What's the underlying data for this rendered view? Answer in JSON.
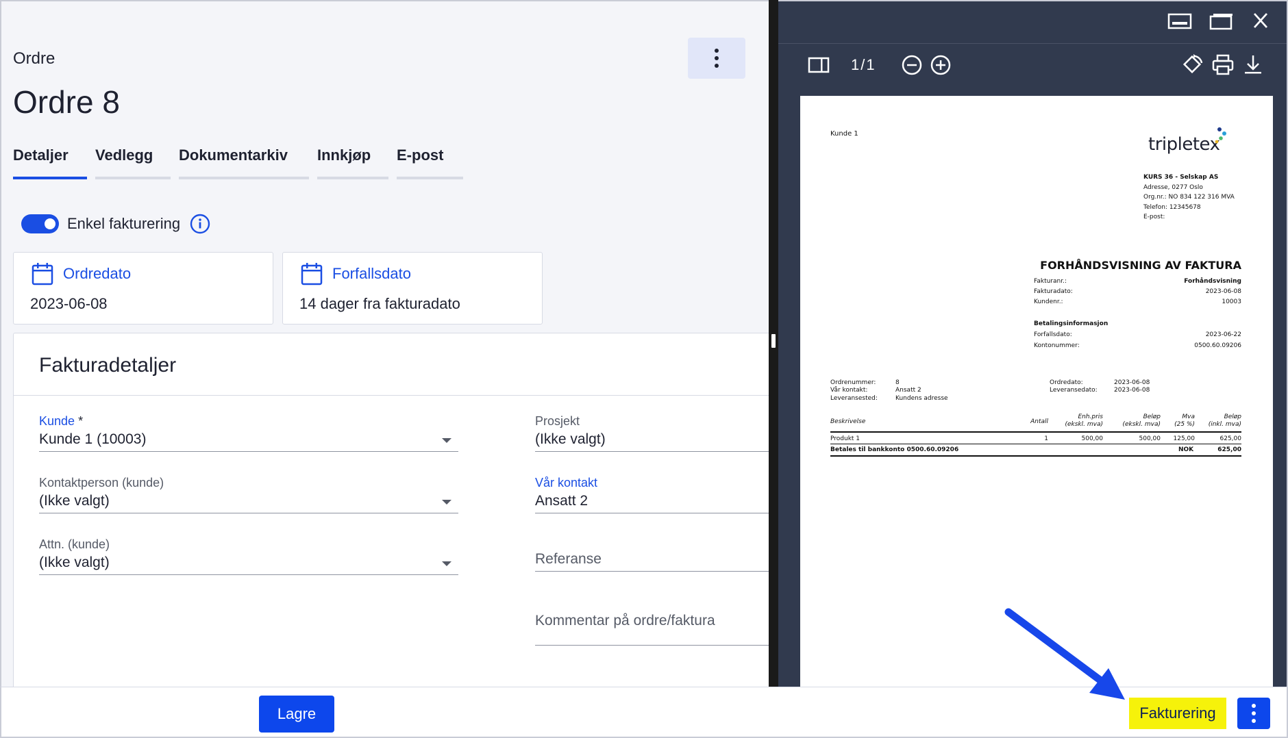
{
  "header": {
    "breadcrumb": "Ordre",
    "title": "Ordre 8"
  },
  "tabs": [
    "Detaljer",
    "Vedlegg",
    "Dokumentarkiv",
    "Innkjøp",
    "E-post"
  ],
  "simple_invoicing": {
    "label": "Enkel fakturering",
    "enabled": true
  },
  "dates": {
    "order_date": {
      "label": "Ordredato",
      "value": "2023-06-08"
    },
    "due_date": {
      "label": "Forfallsdato",
      "value": "14 dager fra fakturadato"
    }
  },
  "invoice_details": {
    "title": "Fakturadetaljer",
    "customer": {
      "label": "Kunde",
      "required_mark": "*",
      "value": "Kunde 1 (10003)"
    },
    "contact": {
      "label": "Kontaktperson (kunde)",
      "value": "(Ikke valgt)"
    },
    "attn": {
      "label": "Attn. (kunde)",
      "value": "(Ikke valgt)"
    },
    "project": {
      "label": "Prosjekt",
      "value": "(Ikke valgt)"
    },
    "our_contact": {
      "label": "Vår kontakt",
      "value": "Ansatt 2"
    },
    "reference": {
      "placeholder": "Referanse"
    },
    "comment": {
      "placeholder": "Kommentar på ordre/faktura"
    }
  },
  "viewer": {
    "page_count": "1/1",
    "icons": [
      "minimize-icon",
      "maximize-icon",
      "close-icon",
      "sidebar-toggle-icon",
      "zoom-out-icon",
      "zoom-in-icon",
      "rotate-icon",
      "print-icon",
      "download-icon"
    ]
  },
  "pdf": {
    "customer_name": "Kunde 1",
    "logo": "tripletex",
    "company": {
      "name": "KURS 36 - Selskap AS",
      "address": "Adresse, 0277 Oslo",
      "org": "Org.nr.:  NO 834 122 316 MVA",
      "phone": "Telefon:  12345678",
      "email": "E-post:"
    },
    "title": "FORHÅNDSVISNING AV FAKTURA",
    "meta": [
      {
        "k": "Fakturanr.:",
        "v": "Forhåndsvisning",
        "bold": true
      },
      {
        "k": "Fakturadato:",
        "v": "2023-06-08"
      },
      {
        "k": "Kundenr.:",
        "v": "10003"
      }
    ],
    "payment_title": "Betalingsinformasjon",
    "payment": [
      {
        "k": "Forfallsdato:",
        "v": "2023-06-22"
      },
      {
        "k": "Kontonummer:",
        "v": "0500.60.09206"
      }
    ],
    "order_left": [
      {
        "k": "Ordrenummer:",
        "v": "8"
      },
      {
        "k": "Vår kontakt:",
        "v": "Ansatt 2"
      },
      {
        "k": "Leveransested:",
        "v": "Kundens adresse"
      }
    ],
    "order_right": [
      {
        "k": "Ordredato:",
        "v": "2023-06-08"
      },
      {
        "k": "Leveransedato:",
        "v": "2023-06-08"
      }
    ],
    "table_headers": {
      "desc": "Beskrivelse",
      "qty": "Antall",
      "unit": [
        "Enh.pris",
        "(ekskl. mva)"
      ],
      "amount": [
        "Beløp",
        "(ekskl. mva)"
      ],
      "vat": [
        "Mva",
        "(25 %)"
      ],
      "total": [
        "Beløp",
        "(inkl. mva)"
      ]
    },
    "rows": [
      {
        "desc": "Produkt 1",
        "qty": "1",
        "unit": "500,00",
        "amount": "500,00",
        "vat": "125,00",
        "total": "625,00"
      }
    ],
    "pay_line": "Betales til bankkonto 0500.60.09206",
    "currency": "NOK",
    "grand_total": "625,00"
  },
  "footer": {
    "save_label": "Lagre",
    "invoice_label": "Fakturering"
  },
  "colors": {
    "primary": "#0d47ec",
    "highlight": "#f6f20a",
    "viewer_bg": "#313a4e"
  }
}
